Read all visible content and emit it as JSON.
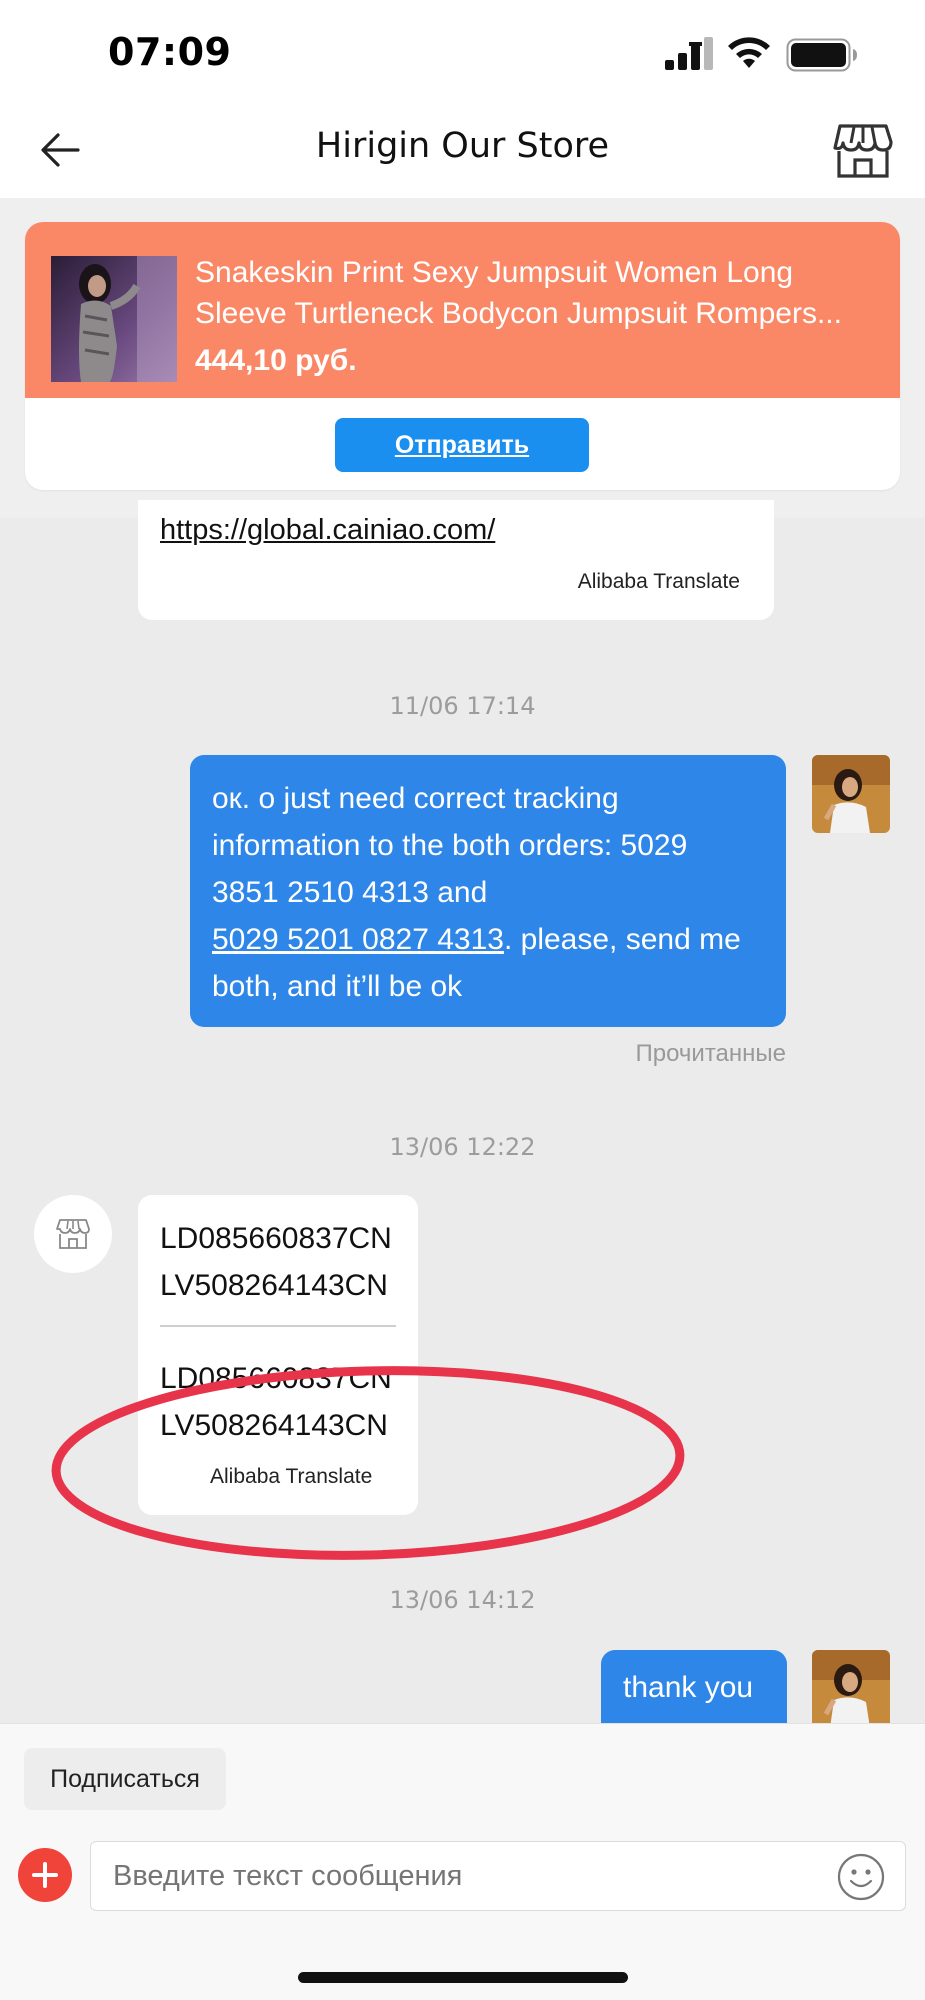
{
  "status_bar": {
    "time": "07:09"
  },
  "nav": {
    "title": "Hirigin Our Store"
  },
  "product": {
    "name_line1": "Snakeskin Print Sexy Jumpsuit Women Long",
    "name_line2": "Sleeve Turtleneck Bodycon Jumpsuit Rompers...",
    "price": "444,10 руб.",
    "send_label": "Отправить"
  },
  "chat": {
    "msg1": {
      "link": "https://global.cainiao.com/",
      "translate_tag": "Alibaba Translate"
    },
    "ts1": "11/06 17:14",
    "msg2": {
      "line1": "ок. o just need correct tracking",
      "line2": "information to the both orders: 5029",
      "line3": "3851 2510 4313 and",
      "line4_link": "5029 5201 0827 4313",
      "line4_rest": ". please, send me",
      "line5": "both, and it’ll be ok",
      "read_status": "Прочитанные"
    },
    "ts2": "13/06 12:22",
    "msg3": {
      "line1": "LD085660837CN",
      "line2": "LV508264143CN",
      "line3": "LD085660837CN",
      "line4": "LV508264143CN",
      "translate_tag": "Alibaba Translate"
    },
    "ts3": "13/06 14:12",
    "msg4": {
      "text": "thank you"
    }
  },
  "bottom": {
    "subscribe_label": "Подписаться",
    "input_placeholder": "Введите текст сообщения"
  },
  "colors": {
    "accent_blue": "#2e86e8",
    "product_orange": "#fa8866",
    "send_button": "#1a8ff0",
    "add_button_red": "#f0433a",
    "annotation_red": "#e8344a"
  },
  "icons": [
    "signal-icon",
    "wifi-icon",
    "battery-icon",
    "back-arrow-icon",
    "store-icon",
    "store-avatar-icon",
    "plus-icon",
    "emoji-icon"
  ]
}
